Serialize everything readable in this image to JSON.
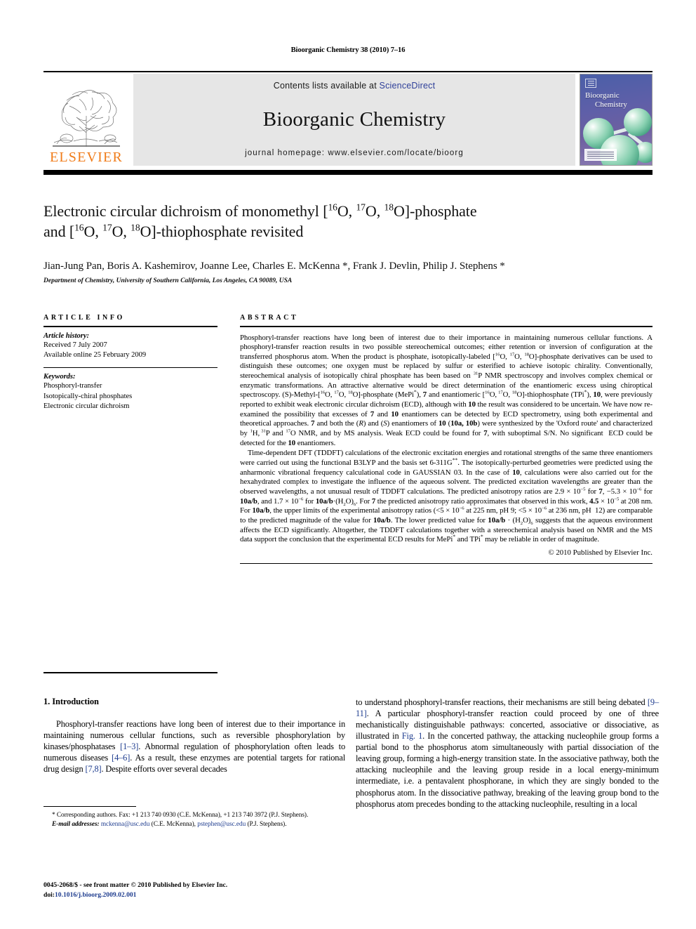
{
  "runhead": "Bioorganic Chemistry 38 (2010) 7–16",
  "header": {
    "contents_prefix": "Contents lists available at ",
    "sciencedirect": "ScienceDirect",
    "journal_name": "Bioorganic Chemistry",
    "homepage": "journal homepage: www.elsevier.com/locate/bioorg",
    "publisher_wordmark": "ELSEVIER",
    "cover_title_line1": "Bioorganic",
    "cover_title_line2": "Chemistry",
    "accent_link_color": "#2e3f99",
    "elsevier_orange": "#f07c1a"
  },
  "article": {
    "title_line1_a": "Electronic circular dichroism of monomethyl [",
    "title_iso1": "16",
    "title_line1_b": "O, ",
    "title_iso2": "17",
    "title_line1_c": "O, ",
    "title_iso3": "18",
    "title_line1_d": "O]-phosphate",
    "title_line2_a": "and [",
    "title_line2_b": "O, ",
    "title_line2_c": "O, ",
    "title_line2_d": "O]-thiophosphate revisited",
    "authors": "Jian-Jung Pan, Boris A. Kashemirov, Joanne Lee, Charles E. McKenna *, Frank J. Devlin, Philip J. Stephens *",
    "affiliation": "Department of Chemistry, University of Southern California, Los Angeles, CA 90089, USA"
  },
  "info": {
    "heading": "ARTICLE INFO",
    "history_label": "Article history:",
    "history_lines": [
      "Received 7 July 2007",
      "Available online 25 February 2009"
    ],
    "keywords_label": "Keywords:",
    "keywords": [
      "Phosphoryl-transfer",
      "Isotopically-chiral phosphates",
      "Electronic circular dichroism"
    ]
  },
  "abstract": {
    "heading": "ABSTRACT",
    "paragraph1": "Phosphoryl-transfer reactions have long been of interest due to their importance in maintaining numerous cellular functions. A phosphoryl-transfer reaction results in two possible stereochemical outcomes; either retention or inversion of configuration at the transferred phosphorus atom. When the product is phosphate, isotopically-labeled [16O, 17O, 18O]-phosphate derivatives can be used to distinguish these outcomes; one oxygen must be replaced by sulfur or esterified to achieve isotopic chirality. Conventionally, stereochemical analysis of isotopically chiral phosphate has been based on 31P NMR spectroscopy and involves complex chemical or enzymatic transformations. An attractive alternative would be direct determination of the enantiomeric excess using chiroptical spectroscopy. (S)-Methyl-[16O, 17O, 18O]-phosphate (MePi*), 7 and enantiomeric [16O, 17O, 18O]-thiophosphate (TPi*), 10, were previously reported to exhibit weak electronic circular dichroism (ECD), although with 10 the result was considered to be uncertain. We have now re-examined the possibility that excesses of 7 and 10 enantiomers can be detected by ECD spectrometry, using both experimental and theoretical approaches. 7 and both the (R) and (S) enantiomers of 10 (10a, 10b) were synthesized by the 'Oxford route' and characterized by 1H, 31P and 17O NMR, and by MS analysis. Weak ECD could be found for 7, with suboptimal S/N. No significant ECD could be detected for the 10 enantiomers.",
    "paragraph2": "Time-dependent DFT (TDDFT) calculations of the electronic excitation energies and rotational strengths of the same three enantiomers were carried out using the functional B3LYP and the basis set 6-311G**. The isotopically-perturbed geometries were predicted using the anharmonic vibrational frequency calculational code in GAUSSIAN 03. In the case of 10, calculations were also carried out for the hexahydrated complex to investigate the influence of the aqueous solvent. The predicted excitation wavelengths are greater than the observed wavelengths, a not unusual result of TDDFT calculations. The predicted anisotropy ratios are 2.9 × 10−5 for 7, −5.3 × 10−6 for 10a/b, and 1.7 × 10−6 for 10a/b·(H2O)6. For 7 the predicted anisotropy ratio approximates that observed in this work, 4.5 × 10−5 at 208 nm. For 10a/b, the upper limits of the experimental anisotropy ratios (<5 × 10−6 at 225 nm, pH 9; <5 × 10−6 at 236 nm, pH 12) are comparable to the predicted magnitude of the value for 10a/b. The lower predicted value for 10a/b·(H2O)6 suggests that the aqueous environment affects the ECD significantly. Altogether, the TDDFT calculations together with a stereochemical analysis based on NMR and the MS data support the conclusion that the experimental ECD results for MePi* and TPi* may be reliable in order of magnitude.",
    "copyright": "© 2010 Published by Elsevier Inc."
  },
  "body": {
    "section_heading": "1. Introduction",
    "left_paragraph": "Phosphoryl-transfer reactions have long been of interest due to their importance in maintaining numerous cellular functions, such as reversible phosphorylation by kinases/phosphatases [1–3]. Abnormal regulation of phosphorylation often leads to numerous diseases [4–6]. As a result, these enzymes are potential targets for rational drug design [7,8]. Despite efforts over several decades",
    "right_paragraph": "to understand phosphoryl-transfer reactions, their mechanisms are still being debated [9–11]. A particular phosphoryl-transfer reaction could proceed by one of three mechanistically distinguishable pathways: concerted, associative or dissociative, as illustrated in Fig. 1. In the concerted pathway, the attacking nucleophile group forms a partial bond to the phosphorus atom simultaneously with partial dissociation of the leaving group, forming a high-energy transition state. In the associative pathway, both the attacking nucleophile and the leaving group reside in a local energy-minimum intermediate, i.e. a pentavalent phosphorane, in which they are singly bonded to the phosphorus atom. In the dissociative pathway, breaking of the leaving group bond to the phosphorus atom precedes bonding to the attacking nucleophile, resulting in a local"
  },
  "footnotes": {
    "corresponding": "* Corresponding authors. Fax: +1 213 740 0930 (C.E. McKenna), +1 213 740 3972 (P.J. Stephens).",
    "email_label": "E-mail addresses:",
    "email1": "mckenna@usc.edu",
    "email1_name": "(C.E. McKenna),",
    "email2": "pstephen@usc.edu",
    "email2_name": "(P.J. Stephens).",
    "issn_line": "0045-2068/$ - see front matter © 2010 Published by Elsevier Inc.",
    "doi_prefix": "doi:",
    "doi": "10.1016/j.bioorg.2009.02.001"
  }
}
